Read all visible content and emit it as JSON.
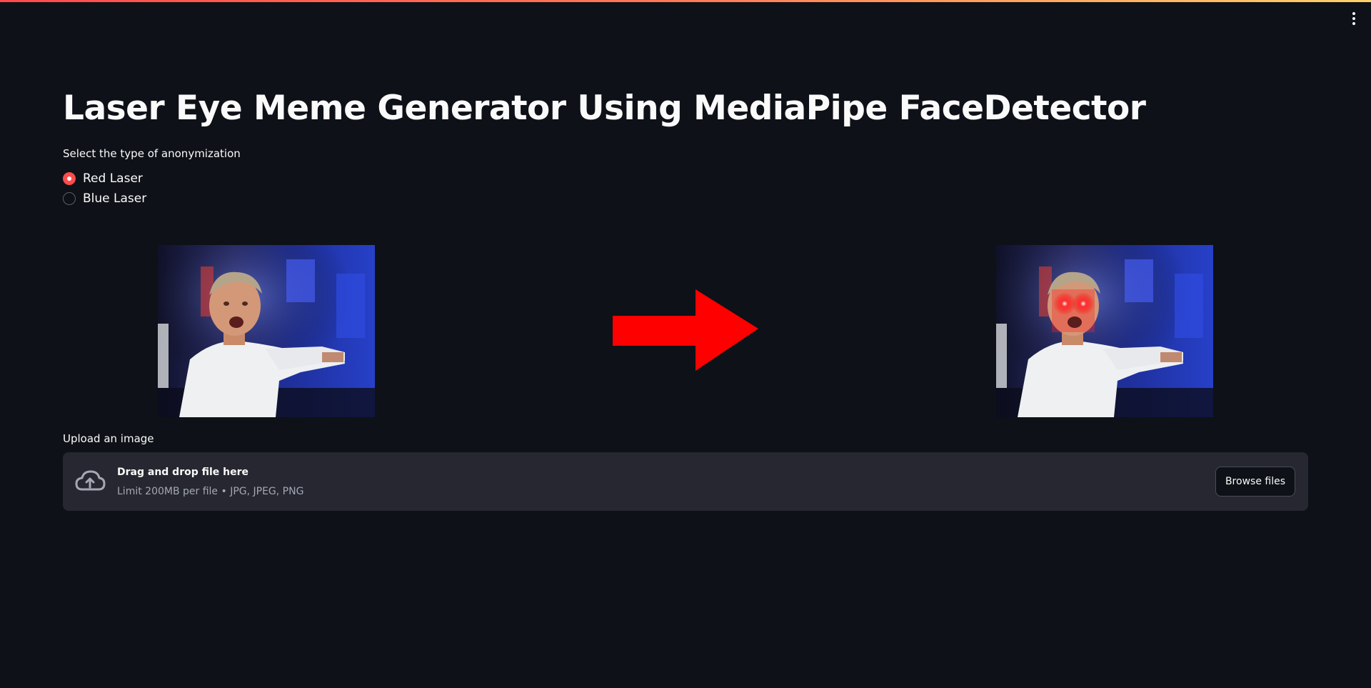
{
  "app": {
    "title": "Laser Eye Meme Generator Using MediaPipe FaceDetector",
    "menu_icon": "vertical-ellipsis-icon"
  },
  "laser_selector": {
    "label": "Select the type of anonymization",
    "options": [
      {
        "label": "Red Laser",
        "checked": true
      },
      {
        "label": "Blue Laser",
        "checked": false
      }
    ]
  },
  "preview": {
    "arrow_icon": "right-arrow-icon",
    "arrow_color": "#ff0000",
    "laser_color": "#ff1a1a"
  },
  "uploader": {
    "label": "Upload an image",
    "icon": "cloud-upload-icon",
    "title": "Drag and drop file here",
    "subtitle": "Limit 200MB per file • JPG, JPEG, PNG",
    "button_label": "Browse files"
  },
  "colors": {
    "background": "#0e1117",
    "accent": "#ff4b4b",
    "panel": "#262730"
  }
}
